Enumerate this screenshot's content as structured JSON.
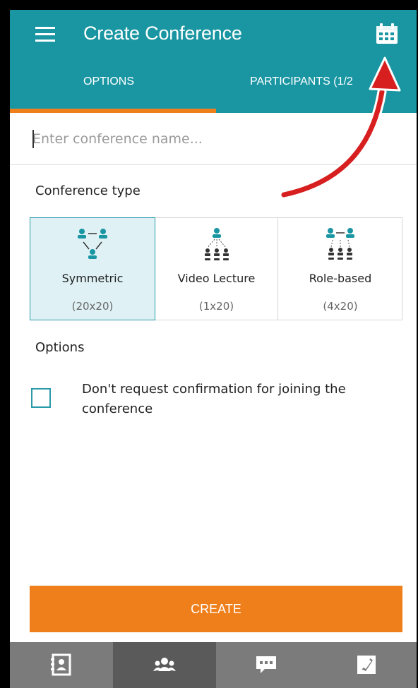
{
  "header": {
    "title": "Create Conference",
    "menu_icon": "hamburger-menu-icon",
    "calendar_icon": "calendar-icon"
  },
  "tabs": [
    {
      "label": "OPTIONS",
      "active": true
    },
    {
      "label": "PARTICIPANTS (1/2"
    }
  ],
  "name_field": {
    "placeholder": "Enter conference name...",
    "value": ""
  },
  "conference_type": {
    "label": "Conference type",
    "items": [
      {
        "name": "Symmetric",
        "capacity": "(20x20)",
        "icon": "symmetric-conference-icon",
        "selected": true
      },
      {
        "name": "Video Lecture",
        "capacity": "(1x20)",
        "icon": "video-lecture-icon",
        "selected": false
      },
      {
        "name": "Role-based",
        "capacity": "(4x20)",
        "icon": "role-based-conference-icon",
        "selected": false
      }
    ]
  },
  "options": {
    "label": "Options",
    "items": [
      {
        "label": "Don't request confirmation for joining the conference",
        "checked": false
      }
    ]
  },
  "create_button": {
    "label": "CREATE"
  },
  "bottom_nav": [
    {
      "icon": "contacts-icon",
      "active": false
    },
    {
      "icon": "conference-icon",
      "active": true
    },
    {
      "icon": "chat-icon",
      "active": false
    },
    {
      "icon": "calls-icon",
      "active": false
    }
  ],
  "colors": {
    "header": "#1a96a3",
    "accent": "#ef7f1a",
    "selected_card": "#dff1f5",
    "nav_bg": "#7b7b7b",
    "annotation_arrow": "#d81f1f"
  }
}
